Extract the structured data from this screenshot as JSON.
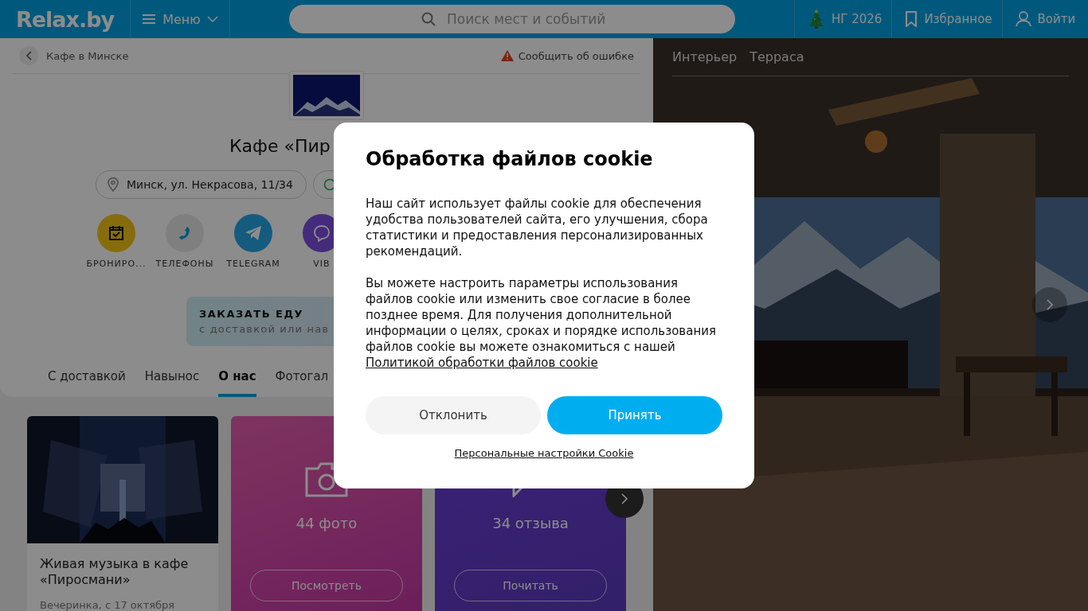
{
  "header": {
    "logo": "Relax.by",
    "menu": "Меню",
    "search_placeholder": "Поиск мест и событий",
    "links": [
      {
        "kind": "tree",
        "text": "НГ 2026"
      },
      {
        "kind": "bookmark",
        "text": "Избранное"
      },
      {
        "kind": "user",
        "text": "Войти"
      }
    ]
  },
  "place": {
    "breadcrumb": "Кафе в Минске",
    "report": "Сообщить об ошибке",
    "title": "Кафе «Пир",
    "address": "Минск, ул. Некрасова, 11/34",
    "actions": [
      {
        "kind": "booking",
        "label": "БРОНИРО..."
      },
      {
        "kind": "phone",
        "label": "ТЕЛЕФОНЫ"
      },
      {
        "kind": "telegram",
        "label": "TELEGRAM"
      },
      {
        "kind": "viber",
        "label": "VIB"
      }
    ],
    "order": {
      "title": "ЗАКАЗАТЬ ЕДУ",
      "subtitle": "с доставкой или нав"
    },
    "tabs": [
      {
        "label": "С доставкой",
        "selected": false
      },
      {
        "label": "Навынос",
        "selected": false
      },
      {
        "label": "О нас",
        "selected": true
      },
      {
        "label": "Фотогал",
        "selected": false
      }
    ]
  },
  "cards": [
    {
      "kind": "event",
      "title": "Живая музыка в кафе «Пиросмани»",
      "meta": "Вечеринка, с 17 октября"
    },
    {
      "kind": "photos",
      "count": "44 фото",
      "button": "Посмотреть"
    },
    {
      "kind": "reviews",
      "count": "34 отзыва",
      "button": "Почитать"
    }
  ],
  "gallery": {
    "tabs": [
      "Интерьер",
      "Терраса"
    ]
  },
  "cookie": {
    "title": "Обработка файлов cookie",
    "paragraphs": [
      "Наш сайт использует файлы cookie для обеспечения удобства пользователей сайта, его улучшения, сбора статистики и предоставления персонализированных рекомендаций.",
      "Вы можете настроить параметры использования файлов cookie или изменить свое согласие в более позднее время. Для получения дополнительной информации о целях, сроках и порядке использования файлов cookie вы можете ознакомиться с нашей"
    ],
    "policy_link": "Политикой обработки файлов cookie",
    "decline": "Отклонить",
    "accept": "Принять",
    "settings_link": "Персональные настройки Cookie"
  }
}
